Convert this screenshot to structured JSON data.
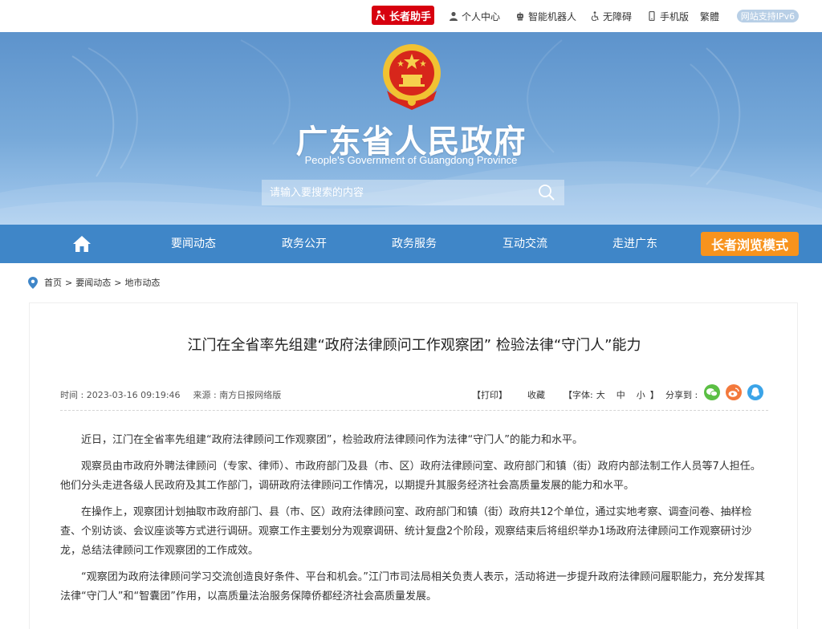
{
  "topbar": {
    "elder_assistant": "长者助手",
    "personal_center": "个人中心",
    "robot": "智能机器人",
    "accessibility": "无障碍",
    "mobile": "手机版",
    "traditional": "繁體",
    "ipv6": "网站支持IPv6"
  },
  "banner": {
    "title": "广东省人民政府",
    "subtitle": "People's Government of Guangdong Province",
    "search_placeholder": "请输入要搜索的内容"
  },
  "nav": {
    "items": [
      "要闻动态",
      "政务公开",
      "政务服务",
      "互动交流",
      "走进广东"
    ],
    "elder_mode": "长者浏览模式"
  },
  "breadcrumb": {
    "home": "首页",
    "level1": "要闻动态",
    "level2": "地市动态",
    "sep": ">"
  },
  "article": {
    "title": "江门在全省率先组建“政府法律顾问工作观察团” 检验法律“守门人”能力",
    "time": "时间 : 2023-03-16 09:19:46",
    "source": "来源 : 南方日报网络版",
    "print": "【打印】",
    "favorite": "收藏",
    "font_label": "【字体:",
    "font_large": "大",
    "font_medium": "中",
    "font_small": "小",
    "font_end": "】",
    "share_label": "分享到 :",
    "paragraphs": [
      "近日，江门在全省率先组建“政府法律顾问工作观察团”，检验政府法律顾问作为法律“守门人”的能力和水平。",
      "观察员由市政府外聘法律顾问（专家、律师）、市政府部门及县（市、区）政府法律顾问室、政府部门和镇（街）政府内部法制工作人员等7人担任。他们分头走进各级人民政府及其工作部门，调研政府法律顾问工作情况，以期提升其服务经济社会高质量发展的能力和水平。",
      "在操作上，观察团计划抽取市政府部门、县（市、区）政府法律顾问室、政府部门和镇（街）政府共12个单位，通过实地考察、调查问卷、抽样检查、个别访谈、会议座谈等方式进行调研。观察工作主要划分为观察调研、统计复盘2个阶段，观察结束后将组织举办1场政府法律顾问工作观察研讨沙龙，总结法律顾问工作观察团的工作成效。",
      "“观察团为政府法律顾问学习交流创造良好条件、平台和机会。”江门市司法局相关负责人表示，活动将进一步提升政府法律顾问履职能力，充分发挥其法律“守门人”和“智囊团”作用，以高质量法治服务保障侨都经济社会高质量发展。"
    ]
  },
  "colors": {
    "brand_red": "#d7000f",
    "nav_blue": "#3f86c8",
    "elder_orange": "#f7931d",
    "wechat_green": "#5bbf44",
    "weibo_orange": "#f3793c",
    "qq_blue": "#3ba4e8"
  },
  "icons": [
    "elder-icon",
    "user-icon",
    "robot-icon",
    "accessibility-icon",
    "mobile-icon",
    "search-icon",
    "home-icon",
    "location-pin-icon",
    "wechat-icon",
    "weibo-icon",
    "qq-icon",
    "national-emblem-icon"
  ]
}
